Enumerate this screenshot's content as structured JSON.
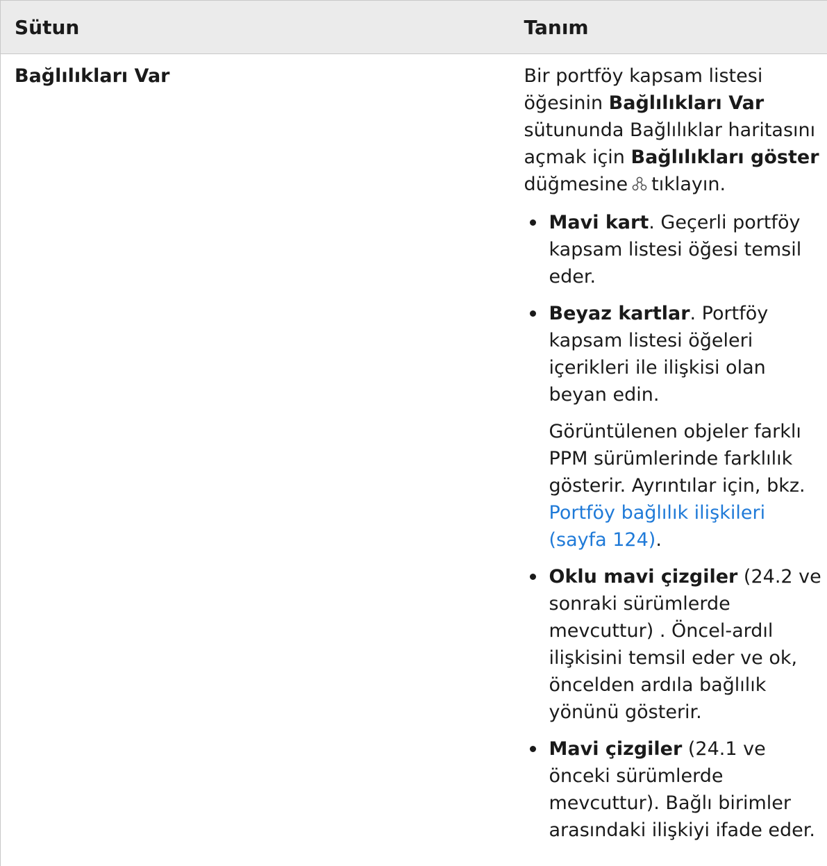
{
  "table": {
    "headers": [
      "Sütun",
      "Tanım"
    ],
    "row": {
      "name": "Bağlılıkları Var",
      "intro": {
        "t1": "Bir portföy kapsam listesi öğesinin ",
        "b1": "Bağlılıkları Var",
        "t2": " sütununda Bağlılıklar haritasını açmak için ",
        "b2": "Bağlılıkları göster",
        "t3": " düğmesine",
        "t4": "tıklayın."
      },
      "bullets": [
        {
          "bold": "Mavi kart",
          "text": ". Geçerli portföy kapsam listesi öğesi temsil eder."
        },
        {
          "bold": "Beyaz kartlar",
          "text": ". Portföy kapsam listesi öğeleri içerikleri ile ilişkisi olan beyan edin.",
          "sub_text": "Görüntülenen objeler farklı PPM sürümlerinde farklılık gösterir. Ayrıntılar için, bkz. ",
          "sub_link": "Portföy bağlılık ilişkileri (sayfa 124)",
          "sub_end": "."
        },
        {
          "bold": "Oklu mavi çizgiler",
          "text": "  (24.2 ve sonraki sürümlerde mevcuttur) . Öncel-ardıl ilişkisini temsil eder ve ok, öncelden ardıla bağlılık yönünü gösterir."
        },
        {
          "bold": "Mavi çizgiler",
          "text": " (24.1 ve önceki sürümlerde mevcuttur). Bağlı birimler arasındaki ilişkiyi ifade eder."
        }
      ]
    }
  },
  "icons": {
    "dependencies_button": "dependency-graph-icon"
  },
  "colors": {
    "link": "#1f7ad8",
    "header_bg": "#ebebeb",
    "border": "#c8c8c8"
  }
}
